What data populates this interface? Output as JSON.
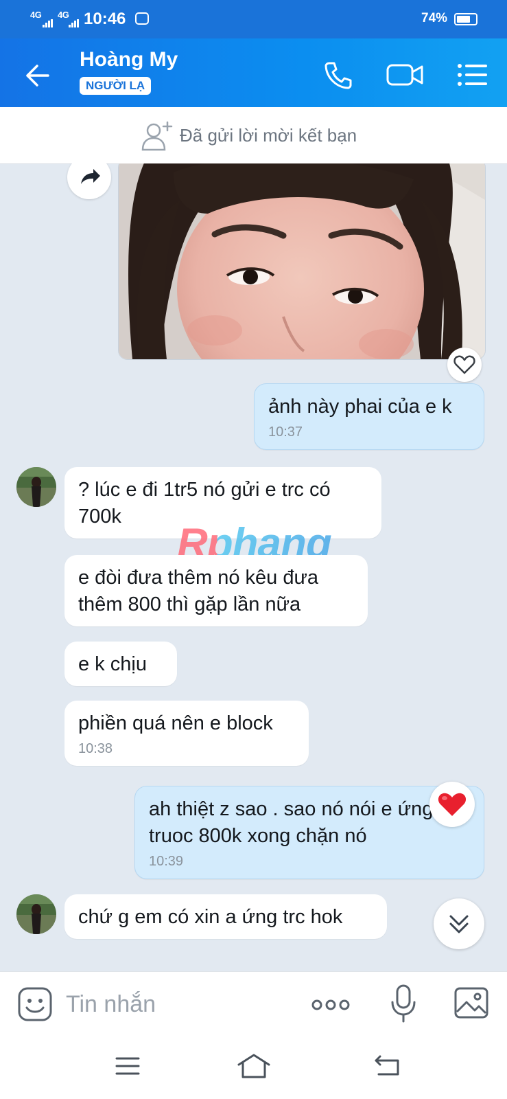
{
  "status_bar": {
    "network1": "4G",
    "network2": "4G",
    "time": "10:46",
    "battery": "74%",
    "battery_level": 0.74
  },
  "header": {
    "contact_name": "Hoàng My",
    "badge": "NGƯỜI LẠ"
  },
  "friend_request": {
    "text": "Đã gửi lời mời kết bạn"
  },
  "messages": [
    {
      "from": "me",
      "text": "ảnh này phai của e k",
      "time": "10:37"
    },
    {
      "from": "contact",
      "text_lines": [
        "? lúc e đi 1tr5 nó gửi e trc có",
        "700k"
      ]
    },
    {
      "from": "contact",
      "text_lines": [
        "e đòi đưa thêm nó kêu đưa",
        "thêm 800 thì gặp lần nữa"
      ]
    },
    {
      "from": "contact",
      "text": "e k chịu"
    },
    {
      "from": "contact",
      "text": "phiền quá nên e block",
      "time": "10:38"
    },
    {
      "from": "me",
      "text_lines": [
        "ah thiệt z sao . sao nó nói e ứng",
        "truoc 800k xong chặn nó"
      ],
      "time": "10:39",
      "reaction": "heart"
    },
    {
      "from": "contact",
      "text": "chứ g em có xin a ứng trc hok"
    }
  ],
  "watermark": "Rphang",
  "composer": {
    "placeholder": "Tin nhắn"
  },
  "colors": {
    "brand": "#1a73d9",
    "my_bubble": "#d3ebfc",
    "chat_bg": "#e2e9f1",
    "reaction": "#e8202e"
  },
  "icons": [
    "back-arrow-icon",
    "phone-icon",
    "video-camera-icon",
    "list-menu-icon",
    "add-friend-icon",
    "share-forward-icon",
    "heart-outline-icon",
    "heart-filled-icon",
    "chevron-double-down-icon",
    "emoji-icon",
    "more-dots-icon",
    "microphone-icon",
    "image-icon",
    "nav-menu-icon",
    "nav-home-icon",
    "nav-back-icon"
  ]
}
